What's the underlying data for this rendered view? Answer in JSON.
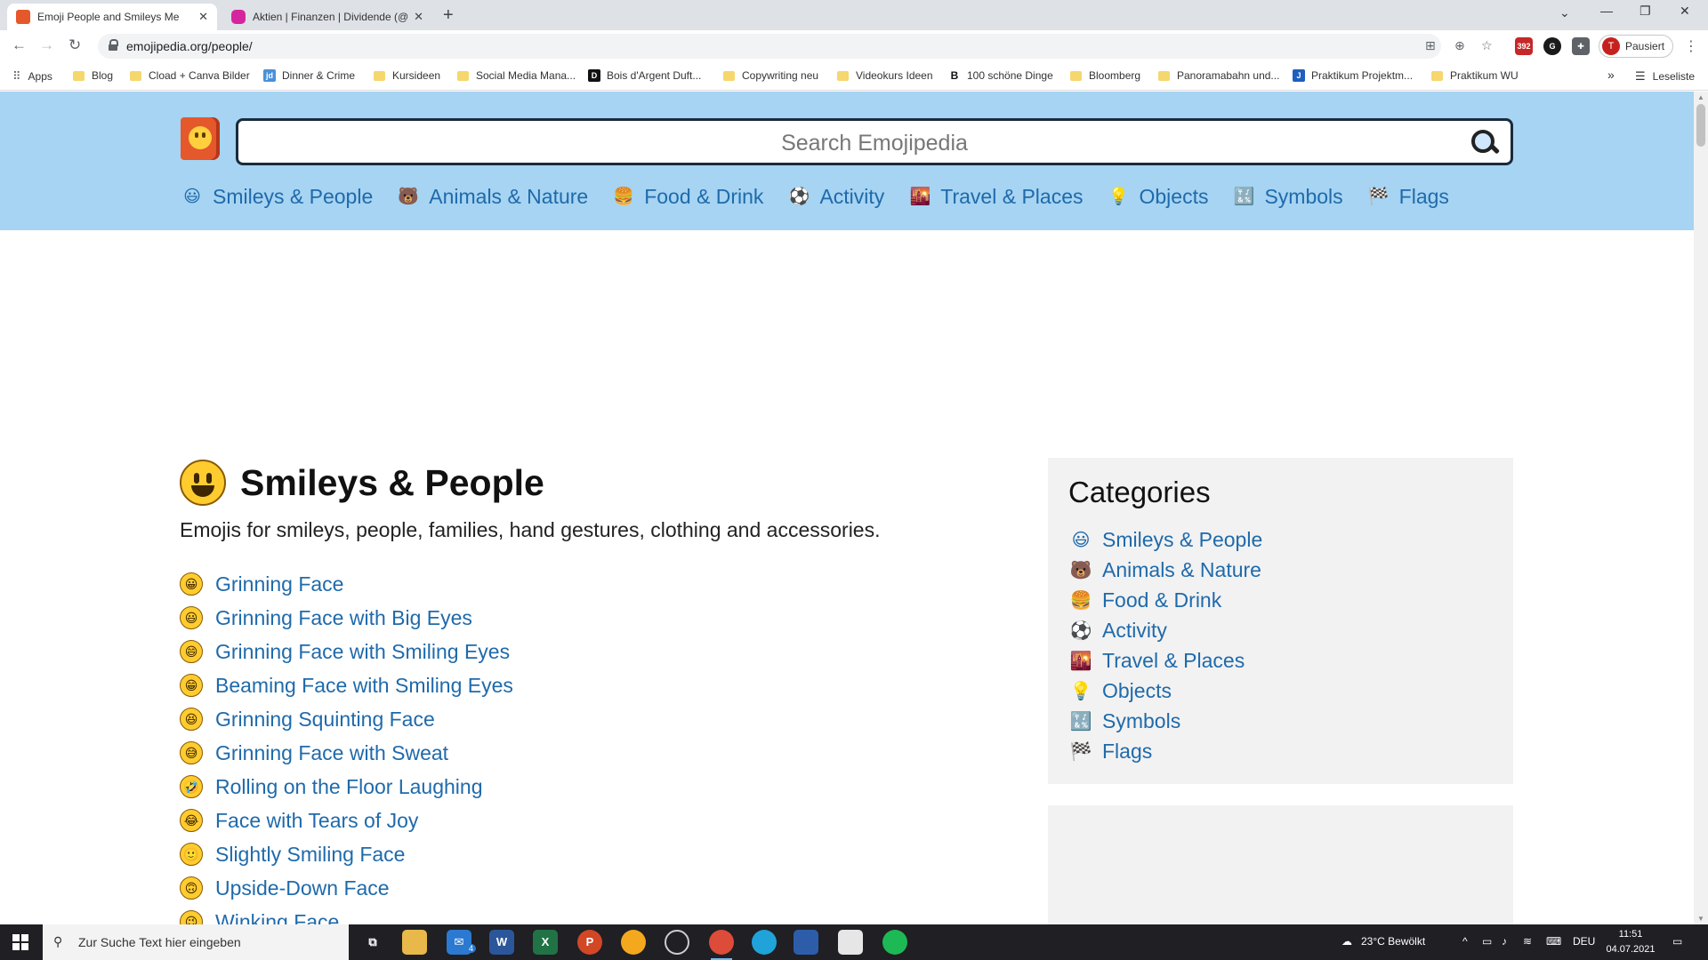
{
  "browser": {
    "tabs": [
      {
        "title": "Emoji People and Smileys Me",
        "favicon_color": "#e4582c",
        "active": true
      },
      {
        "title": "Aktien | Finanzen | Dividende (@",
        "favicon_color": "#d6249f",
        "active": false
      }
    ],
    "new_tab_symbol": "+",
    "url": "emojipedia.org/people/",
    "profile_initial": "T",
    "profile_label": "Pausiert",
    "extension_badge": "392",
    "bookmarks": [
      {
        "label": "Apps",
        "kind": "apps"
      },
      {
        "label": "Blog",
        "kind": "folder"
      },
      {
        "label": "Cload + Canva Bilder",
        "kind": "folder"
      },
      {
        "label": "Dinner & Crime",
        "kind": "site",
        "color": "#4a90d9",
        "glyph": "jd"
      },
      {
        "label": "Kursideen",
        "kind": "folder"
      },
      {
        "label": "Social Media Mana...",
        "kind": "folder"
      },
      {
        "label": "Bois d'Argent Duft...",
        "kind": "site",
        "color": "#111111",
        "glyph": "D"
      },
      {
        "label": "Copywriting neu",
        "kind": "folder"
      },
      {
        "label": "Videokurs Ideen",
        "kind": "folder"
      },
      {
        "label": "100 schöne Dinge",
        "kind": "site",
        "color": "#ffffff",
        "glyph": "B"
      },
      {
        "label": "Bloomberg",
        "kind": "folder"
      },
      {
        "label": "Panoramabahn und...",
        "kind": "folder"
      },
      {
        "label": "Praktikum Projektm...",
        "kind": "site",
        "color": "#1f5fbf",
        "glyph": "J"
      },
      {
        "label": "Praktikum WU",
        "kind": "folder"
      }
    ],
    "bookmarks_overflow": "»",
    "reading_list": "Leseliste"
  },
  "site": {
    "search_placeholder": "Search Emojipedia",
    "nav": [
      {
        "label": "Smileys & People",
        "icon": "😃"
      },
      {
        "label": "Animals & Nature",
        "icon": "🐻"
      },
      {
        "label": "Food & Drink",
        "icon": "🍔"
      },
      {
        "label": "Activity",
        "icon": "⚽"
      },
      {
        "label": "Travel & Places",
        "icon": "🌇"
      },
      {
        "label": "Objects",
        "icon": "💡"
      },
      {
        "label": "Symbols",
        "icon": "🔣"
      },
      {
        "label": "Flags",
        "icon": "🏁"
      }
    ],
    "colors": {
      "header_bg": "#a6d4f2",
      "link": "#1f6aab"
    }
  },
  "main": {
    "title": "Smileys & People",
    "description": "Emojis for smileys, people, families, hand gestures, clothing and accessories.",
    "emojis": [
      {
        "name": "Grinning Face",
        "icon": "😀"
      },
      {
        "name": "Grinning Face with Big Eyes",
        "icon": "😃"
      },
      {
        "name": "Grinning Face with Smiling Eyes",
        "icon": "😄"
      },
      {
        "name": "Beaming Face with Smiling Eyes",
        "icon": "😁"
      },
      {
        "name": "Grinning Squinting Face",
        "icon": "😆"
      },
      {
        "name": "Grinning Face with Sweat",
        "icon": "😅"
      },
      {
        "name": "Rolling on the Floor Laughing",
        "icon": "🤣"
      },
      {
        "name": "Face with Tears of Joy",
        "icon": "😂"
      },
      {
        "name": "Slightly Smiling Face",
        "icon": "🙂"
      },
      {
        "name": "Upside-Down Face",
        "icon": "🙃"
      },
      {
        "name": "Winking Face",
        "icon": "😉"
      }
    ]
  },
  "sidebar": {
    "title": "Categories",
    "categories": [
      {
        "label": "Smileys & People",
        "icon": "😃"
      },
      {
        "label": "Animals & Nature",
        "icon": "🐻"
      },
      {
        "label": "Food & Drink",
        "icon": "🍔"
      },
      {
        "label": "Activity",
        "icon": "⚽"
      },
      {
        "label": "Travel & Places",
        "icon": "🌇"
      },
      {
        "label": "Objects",
        "icon": "💡"
      },
      {
        "label": "Symbols",
        "icon": "🔣"
      },
      {
        "label": "Flags",
        "icon": "🏁"
      }
    ]
  },
  "taskbar": {
    "search_placeholder": "Zur Suche Text hier eingeben",
    "mail_badge": "4",
    "weather": "23°C  Bewölkt",
    "language": "DEU",
    "time": "11:51",
    "date": "04.07.2021"
  }
}
